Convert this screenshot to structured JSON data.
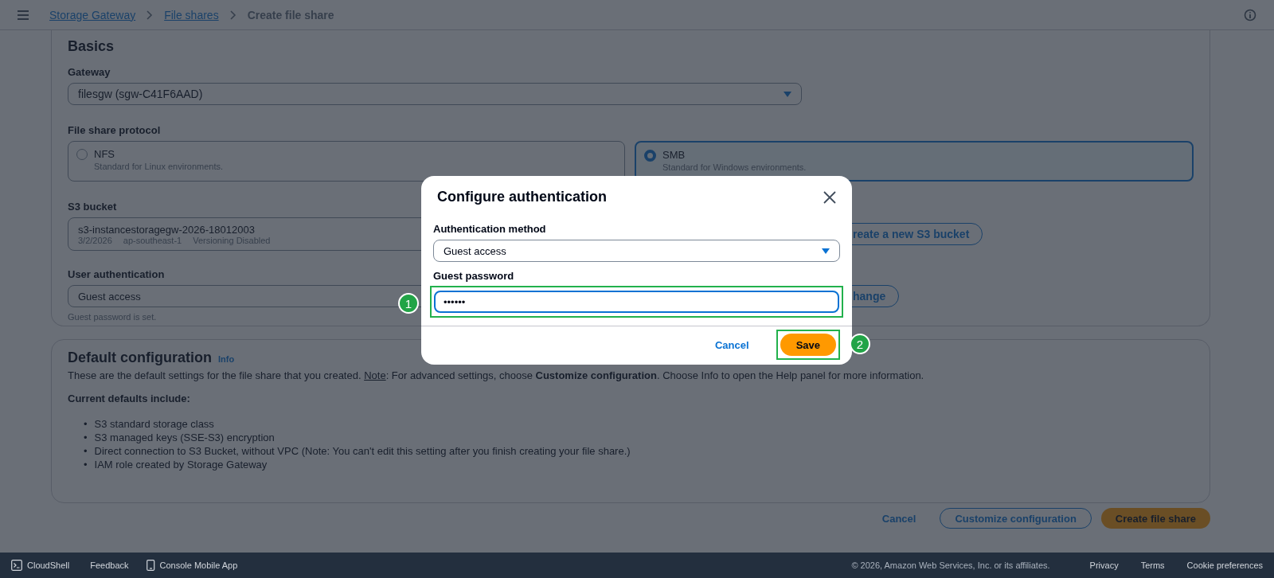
{
  "breadcrumbs": [
    {
      "label": "Storage Gateway",
      "kind": "link"
    },
    {
      "label": "File shares",
      "kind": "link"
    },
    {
      "label": "Create file share",
      "kind": "current"
    }
  ],
  "basics": {
    "title": "Basics",
    "gateway": {
      "label": "Gateway",
      "value": "filesgw (sgw-C41F6AAD)"
    },
    "protocol": {
      "label": "File share protocol",
      "options": [
        {
          "label": "NFS",
          "description": "Standard for Linux environments.",
          "selected": false
        },
        {
          "label": "SMB",
          "description": "Standard for Windows environments.",
          "selected": true
        }
      ]
    },
    "s3_bucket": {
      "label": "S3 bucket",
      "value": "s3-instancestoragegw-2026-18012003",
      "meta": [
        "3/2/2026",
        "ap-southeast-1",
        "Versioning Disabled"
      ],
      "button": "reate a new S3 bucket"
    },
    "user_auth": {
      "label": "User authentication",
      "value": "Guest access",
      "hint": "Guest password is set.",
      "button": "hange"
    }
  },
  "default_config": {
    "title": "Default configuration",
    "info": "Info",
    "text_before": "These are the default settings for the file share that you created. ",
    "note": "Note",
    "text_after": ": For advanced settings, choose **Customize configuration**. Choose Info to open the Help panel for more information.",
    "defaults_heading": "Current defaults include:",
    "defaults": [
      {
        "bullet": "•",
        "text": "S3 standard storage class"
      },
      {
        "bullet": "•",
        "text": "S3 managed keys (SSE-S3) encryption"
      },
      {
        "bullet": "•",
        "text": "Direct connection to S3 Bucket, without VPC (Note: You can't edit this setting after you finish creating your file share.)"
      },
      {
        "bullet": "•",
        "text": "IAM role created by Storage Gateway"
      }
    ]
  },
  "actions": [
    {
      "label": "Cancel",
      "kind": "link"
    },
    {
      "label": "Customize configuration",
      "kind": "secondary"
    },
    {
      "label": "Create file share",
      "kind": "primary"
    }
  ],
  "modal": {
    "title": "Configure authentication",
    "method": {
      "label": "Authentication method",
      "value": "Guest access"
    },
    "password": {
      "label": "Guest password",
      "value": "••••••",
      "callout": "1"
    },
    "buttons": [
      {
        "label": "Cancel",
        "kind": "link"
      },
      {
        "label": "Save",
        "kind": "primary",
        "callout": "2"
      }
    ]
  },
  "footer": {
    "left": [
      {
        "label": "CloudShell",
        "kind": "shell"
      },
      {
        "label": "Feedback",
        "kind": "plain"
      },
      {
        "label": "Console Mobile App",
        "kind": "phone"
      }
    ],
    "copyright": "© 2026, Amazon Web Services, Inc. or its affiliates.",
    "links": [
      "Privacy",
      "Terms",
      "Cookie preferences"
    ]
  }
}
